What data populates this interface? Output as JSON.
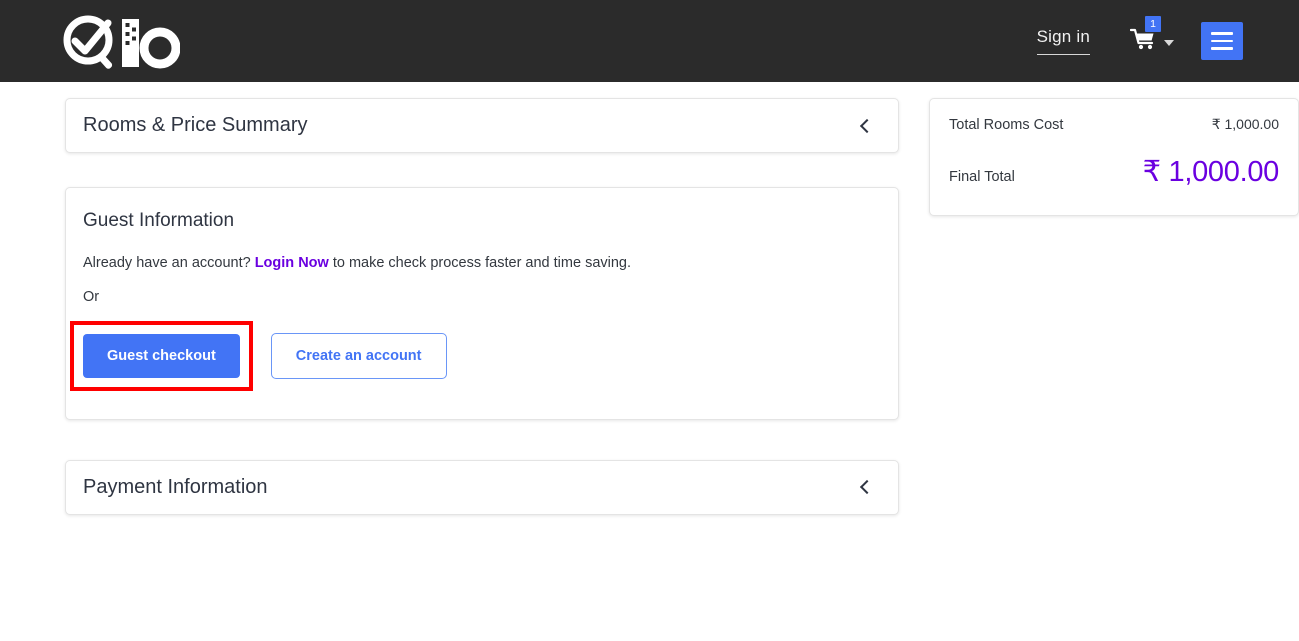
{
  "header": {
    "logo_alt": "Qio logo",
    "signin_label": "Sign in",
    "cart_badge_count": "1",
    "menu_label": "",
    "background_color": "#2b2b2b",
    "accent_color": "#4274f5"
  },
  "panels": {
    "rooms_summary_title": "Rooms & Price Summary",
    "payment_title": "Payment Information"
  },
  "guest": {
    "title": "Guest Information",
    "intro_prefix": "Already have an account? ",
    "login_link": "Login Now",
    "intro_suffix": " to make check process faster and time saving.",
    "or_label": "Or",
    "guest_checkout_label": "Guest checkout",
    "create_account_label": "Create an account",
    "link_color": "#6a00e0",
    "highlight_color": "#ff0000"
  },
  "summary": {
    "rooms_cost_label": "Total Rooms Cost",
    "rooms_cost_value": "₹ 1,000.00",
    "final_total_label": "Final Total",
    "final_total_value": "₹ 1,000.00",
    "total_color": "#6a00e0"
  }
}
